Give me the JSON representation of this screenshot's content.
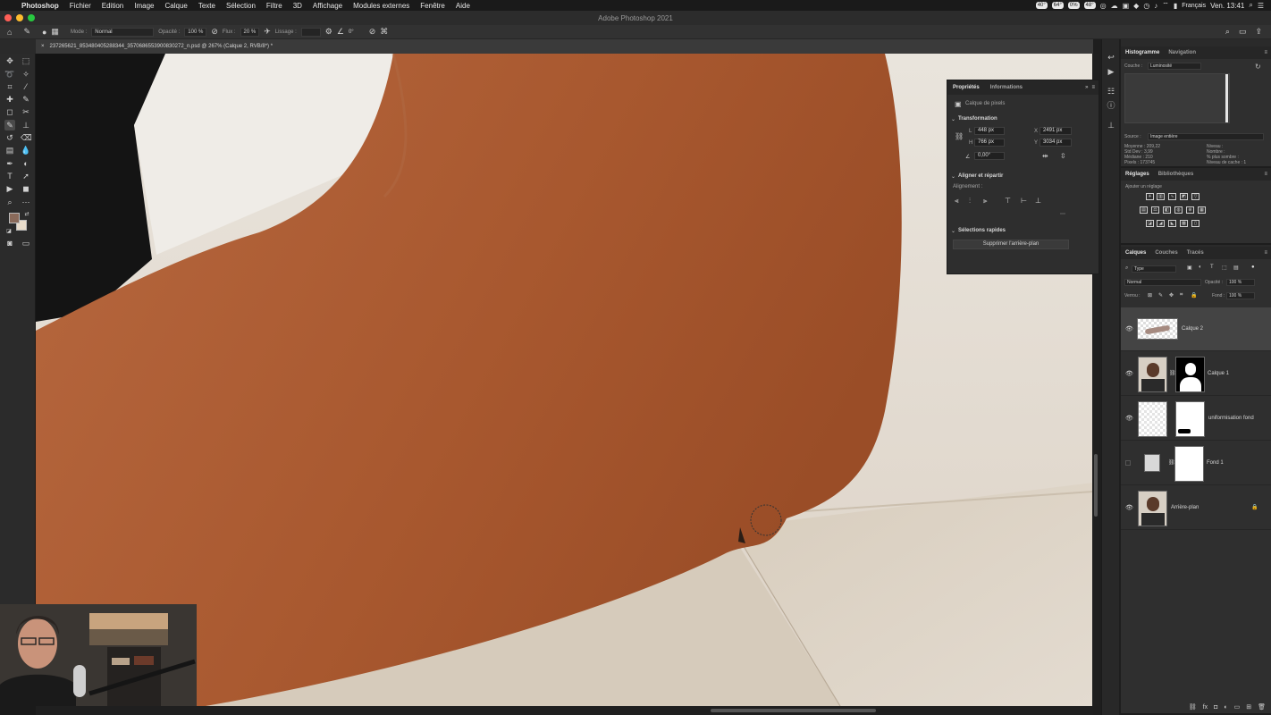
{
  "menubar": {
    "items": [
      "Photoshop",
      "Fichier",
      "Edition",
      "Image",
      "Calque",
      "Texte",
      "Sélection",
      "Filtre",
      "3D",
      "Affichage",
      "Modules externes",
      "Fenêtre",
      "Aide"
    ],
    "stats": [
      "40°",
      "64°",
      "0%",
      "48°"
    ],
    "language": "Français",
    "clock": "Ven. 13:41"
  },
  "window": {
    "title": "Adobe Photoshop 2021"
  },
  "options": {
    "mode_label": "Mode :",
    "mode_value": "Normal",
    "opacity_label": "Opacité :",
    "opacity_value": "100 %",
    "flux_label": "Flux :",
    "flux_value": "20 %",
    "lissage_label": "Lissage :",
    "lissage_value": "",
    "angle_value": "0°"
  },
  "document": {
    "tab_title": "237265621_853480405288344_3570686553900830272_n.psd @ 267% (Calque 2, RVB/8*) *"
  },
  "properties": {
    "tabs": [
      "Propriétés",
      "Informations"
    ],
    "layer_kind": "Calque de pixels",
    "transform_title": "Transformation",
    "w_label": "L",
    "w_value": "448 px",
    "h_label": "H",
    "h_value": "766 px",
    "x_label": "X",
    "x_value": "2491 px",
    "y_label": "Y",
    "y_value": "3034 px",
    "angle_value": "0,00°",
    "align_title": "Aligner et répartir",
    "align_sub": "Alignement :",
    "quick_title": "Sélections rapides",
    "remove_bg_label": "Supprimer l'arrière-plan"
  },
  "histogram": {
    "tabs": [
      "Histogramme",
      "Navigation"
    ],
    "channel_label": "Couche :",
    "channel_value": "Luminosité",
    "source_label": "Source :",
    "source_value": "Image entière",
    "stats_left": [
      "Moyenne : 209,22",
      "Std Dev : 3,99",
      "Médiane : 210",
      "Pixels : 173745"
    ],
    "stats_right": [
      "Niveau :",
      "Nombre :",
      "% plus sombre :",
      "Niveau de cache : 1"
    ]
  },
  "adjustments": {
    "tabs": [
      "Réglages",
      "Bibliothèques"
    ],
    "add_label": "Ajouter un réglage"
  },
  "layers_panel": {
    "tabs": [
      "Calques",
      "Couches",
      "Tracés"
    ],
    "filter_value": "Type",
    "blend_value": "Normal",
    "opacity_label": "Opacité :",
    "opacity_value": "100 %",
    "lock_label": "Verrou :",
    "fill_label": "Fond :",
    "fill_value": "100 %",
    "layers": [
      {
        "name": "Calque 2",
        "visible": true,
        "selected": true
      },
      {
        "name": "Calque 1",
        "visible": true,
        "selected": false
      },
      {
        "name": "uniformisation fond",
        "visible": true,
        "selected": false
      },
      {
        "name": "Fond 1",
        "visible": false,
        "selected": false
      },
      {
        "name": "Arrière-plan",
        "visible": true,
        "selected": false,
        "locked": true
      }
    ],
    "footer_icons": [
      "link-icon",
      "fx-icon",
      "mask-icon",
      "adjustment-icon",
      "group-icon",
      "new-layer-icon",
      "trash-icon"
    ]
  },
  "colors": {
    "accent": "#3b3b3b",
    "foreground_swatch": "#8a6a5a",
    "background_swatch": "#e8dccb",
    "skin": "#b8693e",
    "wall": "#e2dbd1"
  }
}
